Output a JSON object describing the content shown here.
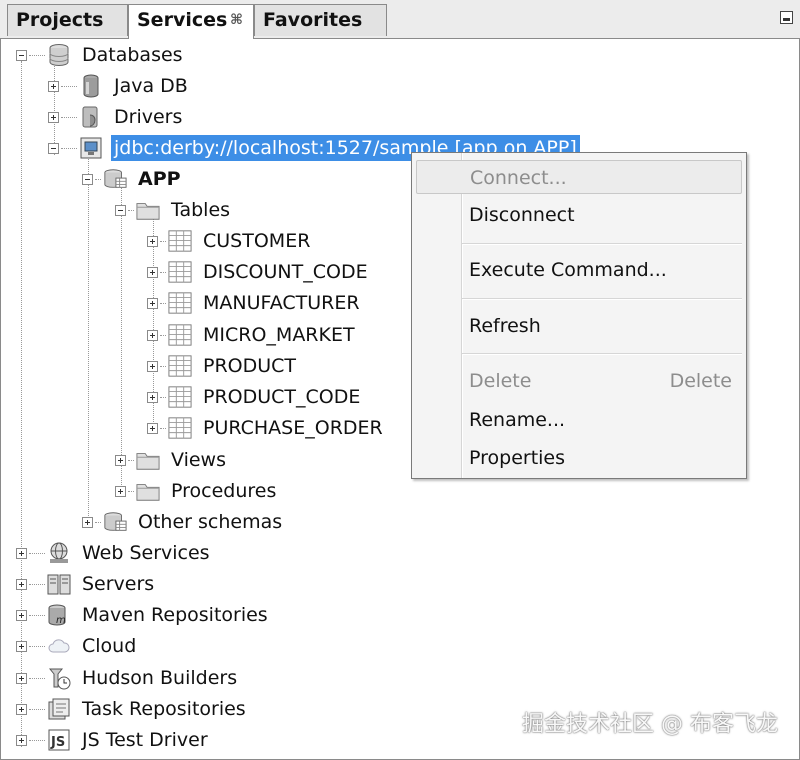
{
  "tabs": [
    {
      "label": "Projects"
    },
    {
      "label": "Services",
      "close_glyph": "⌘"
    },
    {
      "label": "Favorites"
    }
  ],
  "tree": {
    "databases": "Databases",
    "java_db": "Java DB",
    "drivers": "Drivers",
    "connection": "jdbc:derby://localhost:1527/sample [app on APP]",
    "schema_app": "APP",
    "tables": "Tables",
    "table_items": [
      "CUSTOMER",
      "DISCOUNT_CODE",
      "MANUFACTURER",
      "MICRO_MARKET",
      "PRODUCT",
      "PRODUCT_CODE",
      "PURCHASE_ORDER"
    ],
    "views": "Views",
    "procedures": "Procedures",
    "other_schemas": "Other schemas",
    "root_items": [
      "Web Services",
      "Servers",
      "Maven Repositories",
      "Cloud",
      "Hudson Builders",
      "Task Repositories",
      "JS Test Driver"
    ]
  },
  "context_menu": {
    "connect": "Connect...",
    "disconnect": "Disconnect",
    "execute_command": "Execute Command...",
    "refresh": "Refresh",
    "delete": "Delete",
    "delete_shortcut": "Delete",
    "rename": "Rename...",
    "properties": "Properties"
  },
  "watermark": "掘金技术社区 @ 布客飞龙",
  "colors": {
    "selection": "#3d8ee6",
    "disabled_text": "#8d8d8d"
  }
}
